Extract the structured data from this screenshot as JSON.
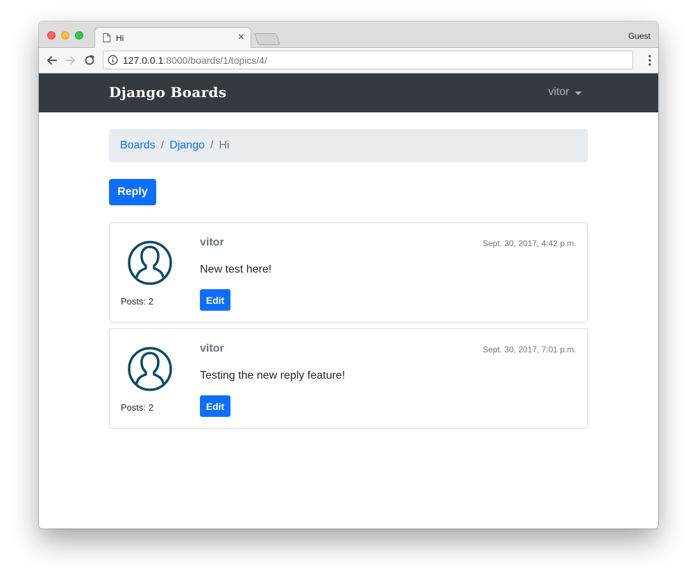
{
  "browser": {
    "tab_title": "Hi",
    "tab_close": "×",
    "profile": "Guest",
    "url_host": "127.0.0.1",
    "url_rest": ":8000/boards/1/topics/4/"
  },
  "navbar": {
    "brand": "Django Boards",
    "user": "vitor"
  },
  "breadcrumb": {
    "items": [
      "Boards",
      "Django"
    ],
    "separator": "/",
    "active": "Hi"
  },
  "reply_button": "Reply",
  "posts": [
    {
      "author": "vitor",
      "date": "Sept. 30, 2017, 4:42 p.m.",
      "message": "New test here!",
      "posts_count": "Posts: 2",
      "edit_label": "Edit"
    },
    {
      "author": "vitor",
      "date": "Sept. 30, 2017, 7:01 p.m.",
      "message": "Testing the new reply feature!",
      "posts_count": "Posts: 2",
      "edit_label": "Edit"
    }
  ],
  "colors": {
    "primary": "#0d6efd",
    "navbar": "#343a40",
    "avatar": "#0b4a68"
  }
}
